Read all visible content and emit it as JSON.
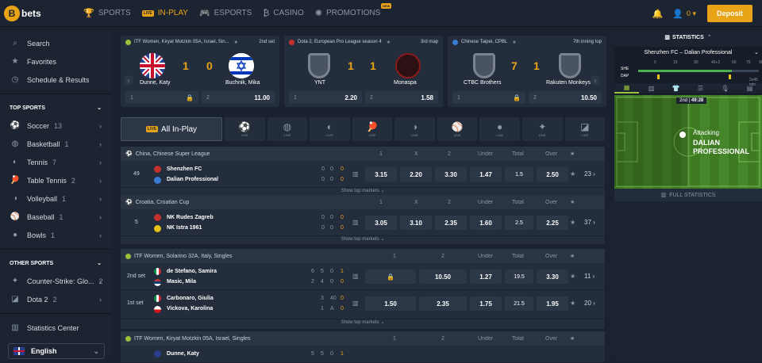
{
  "brand": "bets",
  "nav": [
    {
      "label": "SPORTS",
      "icon": "trophy-icon"
    },
    {
      "label": "IN-PLAY",
      "icon": "live-icon",
      "active": true
    },
    {
      "label": "ESPORTS",
      "icon": "gamepad-icon"
    },
    {
      "label": "CASINO",
      "icon": "casino-icon"
    },
    {
      "label": "PROMOTIONS",
      "icon": "promo-icon",
      "badge": "NEW"
    }
  ],
  "header": {
    "balance": "0",
    "deposit_label": "Deposit"
  },
  "sidebar": {
    "search": "Search",
    "favorites": "Favorites",
    "schedule": "Schedule & Results",
    "top_sports_title": "TOP SPORTS",
    "top_sports": [
      {
        "label": "Soccer",
        "count": "13"
      },
      {
        "label": "Basketball",
        "count": "1"
      },
      {
        "label": "Tennis",
        "count": "7"
      },
      {
        "label": "Table Tennis",
        "count": "2"
      },
      {
        "label": "Volleyball",
        "count": "1"
      },
      {
        "label": "Baseball",
        "count": "1"
      },
      {
        "label": "Bowls",
        "count": "1"
      }
    ],
    "other_sports_title": "OTHER SPORTS",
    "other_sports": [
      {
        "label": "Counter-Strike: Glo...",
        "count": "2"
      },
      {
        "label": "Dota 2",
        "count": "2"
      }
    ],
    "statistics_center": "Statistics Center",
    "language": "English"
  },
  "featured": [
    {
      "league": "ITF Women, Kiryat Motzkin 05A, Israel, Sin...",
      "status": "2nd set",
      "home": "Dunne, Katy",
      "away": "Buchnik, Mika",
      "home_score": "1",
      "away_score": "0",
      "o1_label": "1",
      "o1": "",
      "o2_label": "2",
      "o2": "11.00"
    },
    {
      "league": "Dota 2, European Pro League season 4",
      "status": "3rd map",
      "home": "YNT",
      "away": "Monaspa",
      "home_score": "1",
      "away_score": "1",
      "o1_label": "1",
      "o1": "2.20",
      "o2_label": "2",
      "o2": "1.58"
    },
    {
      "league": "Chinese Taipei, CPBL",
      "status": "7th inning top",
      "home": "CTBC Brothers",
      "away": "Rakuten Monkeys",
      "home_score": "7",
      "away_score": "1",
      "o1_label": "1",
      "o1": "",
      "o2_label": "2",
      "o2": "10.50"
    }
  ],
  "all_in_play": "All In-Play",
  "live_tag": "LIVE",
  "events": [
    {
      "league": "China, Chinese Super League",
      "cols": [
        "1",
        "X",
        "2",
        "Under",
        "Total",
        "Over"
      ],
      "meta": "49",
      "home": "Shenzhen FC",
      "away": "Dalian Professional",
      "hs": [
        "0",
        "0"
      ],
      "as": [
        "0",
        "0"
      ],
      "hsc": "0",
      "asc": "0",
      "odds": [
        "3.15",
        "2.20",
        "3.30",
        "1.47",
        "1.5",
        "2.50"
      ],
      "more": "23",
      "show": "Show top markets"
    },
    {
      "league": "Croatia, Croatian Cup",
      "cols": [
        "1",
        "X",
        "2",
        "Under",
        "Total",
        "Over"
      ],
      "meta": "5",
      "home": "NK Rudes Zagreb",
      "away": "NK Istra 1961",
      "hs": [
        "0",
        "0"
      ],
      "as": [
        "0",
        "0"
      ],
      "hsc": "0",
      "asc": "0",
      "odds": [
        "3.05",
        "3.10",
        "2.35",
        "1.60",
        "2.5",
        "2.25"
      ],
      "more": "37",
      "show": "Show top markets"
    },
    {
      "league": "ITF Women, Solarino 32A, Italy, Singles",
      "cols": [
        "1",
        "2",
        "Under",
        "Total",
        "Over"
      ],
      "rows": [
        {
          "meta": "2nd set",
          "home": "de Stefano, Samira",
          "away": "Masic, Mila",
          "hs": [
            "6",
            "5",
            "0"
          ],
          "as": [
            "2",
            "4",
            "0"
          ],
          "hsc": "1",
          "asc": "0",
          "odds": [
            "",
            "10.50",
            "1.27",
            "19.5",
            "3.30"
          ],
          "more": "11"
        },
        {
          "meta": "1st set",
          "home": "Carbonaro, Giulia",
          "away": "Vickova, Karolina",
          "hs": [
            "3",
            "40"
          ],
          "as": [
            "1",
            "A"
          ],
          "hsc": "0",
          "asc": "0",
          "odds": [
            "1.50",
            "2.35",
            "1.75",
            "21.5",
            "1.95"
          ],
          "more": "20"
        }
      ],
      "show": "Show top markets"
    },
    {
      "league": "ITF Women, Kiryat Motzkin 05A, Israel, Singles",
      "cols": [
        "1",
        "2",
        "Under",
        "Total",
        "Over"
      ],
      "rows": [
        {
          "home": "Dunne, Katy",
          "hs": [
            "5",
            "5",
            "0"
          ],
          "hsc": "1"
        }
      ]
    }
  ],
  "stats_panel": {
    "title": "STATISTICS",
    "match": "Shenzhen FC – Dalian Professional",
    "ticks": [
      "0",
      "15",
      "30",
      "45+2",
      "60",
      "75",
      "90"
    ],
    "home_abbr": "SHE",
    "away_abbr": "DAP",
    "minute_note": "2x45 min",
    "period": "2nd",
    "clock": "49:28",
    "attack_label": "Attacking",
    "attack_team_1": "DALIAN",
    "attack_team_2": "PROFESSIONAL",
    "full_stats": "FULL STATISTICS"
  }
}
